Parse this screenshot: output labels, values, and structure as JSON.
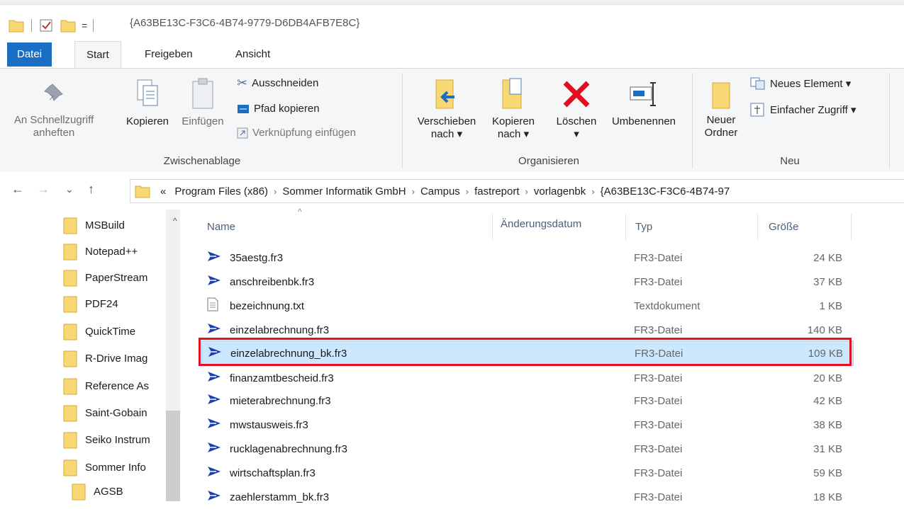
{
  "window": {
    "title": "{A63BE13C-F3C6-4B74-9779-D6DB4AFB7E8C}",
    "qa_dropdown": "="
  },
  "ribbon_tabs": [
    "Datei",
    "Start",
    "Freigeben",
    "Ansicht"
  ],
  "ribbon": {
    "clipboard": {
      "label": "Zwischenablage",
      "pin": "An Schnellzugriff anheften",
      "pin_line1": "An Schnellzugriff",
      "pin_line2": "anheften",
      "copy": "Kopieren",
      "paste": "Einfügen",
      "cut": "Ausschneiden",
      "copy_path": "Pfad kopieren",
      "paste_shortcut": "Verknüpfung einfügen"
    },
    "organize": {
      "label": "Organisieren",
      "move_line1": "Verschieben",
      "move_line2": "nach ▾",
      "copyto_line1": "Kopieren",
      "copyto_line2": "nach ▾",
      "delete": "Löschen",
      "delete_arrow": "▾",
      "rename": "Umbenennen"
    },
    "new": {
      "label": "Neu",
      "new_folder_line1": "Neuer",
      "new_folder_line2": "Ordner",
      "new_item": "Neues Element ▾",
      "easy_access": "Einfacher Zugriff ▾"
    }
  },
  "address": {
    "back": "←",
    "forward": "→",
    "recent": "⌄",
    "up": "↑",
    "overflow": "«",
    "crumbs": [
      "Program Files (x86)",
      "Sommer Informatik GmbH",
      "Campus",
      "fastreport",
      "vorlagenbk",
      "{A63BE13C-F3C6-4B74-97"
    ]
  },
  "nav_pane": {
    "items": [
      "MSBuild",
      "Notepad++",
      "PaperStream",
      "PDF24",
      "QuickTime",
      "R-Drive Imag",
      "Reference As",
      "Saint-Gobain",
      "Seiko Instrum",
      "Sommer Info",
      "AGSB"
    ]
  },
  "columns": {
    "name": "Name",
    "date": "Änderungsdatum",
    "type": "Typ",
    "size": "Größe",
    "sort_indicator": "^"
  },
  "files": [
    {
      "name": "35aestg.fr3",
      "type": "FR3-Datei",
      "size": "24 KB",
      "icon": "fastreport-icon"
    },
    {
      "name": "anschreibenbk.fr3",
      "type": "FR3-Datei",
      "size": "37 KB",
      "icon": "fastreport-icon"
    },
    {
      "name": "bezeichnung.txt",
      "type": "Textdokument",
      "size": "1 KB",
      "icon": "text-file-icon"
    },
    {
      "name": "einzelabrechnung.fr3",
      "type": "FR3-Datei",
      "size": "140 KB",
      "icon": "fastreport-icon"
    },
    {
      "name": "einzelabrechnung_bk.fr3",
      "type": "FR3-Datei",
      "size": "109 KB",
      "icon": "fastreport-icon",
      "selected": true
    },
    {
      "name": "finanzamtbescheid.fr3",
      "type": "FR3-Datei",
      "size": "20 KB",
      "icon": "fastreport-icon"
    },
    {
      "name": "mieterabrechnung.fr3",
      "type": "FR3-Datei",
      "size": "42 KB",
      "icon": "fastreport-icon"
    },
    {
      "name": "mwstausweis.fr3",
      "type": "FR3-Datei",
      "size": "38 KB",
      "icon": "fastreport-icon"
    },
    {
      "name": "rucklagenabrechnung.fr3",
      "type": "FR3-Datei",
      "size": "31 KB",
      "icon": "fastreport-icon"
    },
    {
      "name": "wirtschaftsplan.fr3",
      "type": "FR3-Datei",
      "size": "59 KB",
      "icon": "fastreport-icon"
    },
    {
      "name": "zaehlerstamm_bk.fr3",
      "type": "FR3-Datei",
      "size": "18 KB",
      "icon": "fastreport-icon"
    }
  ],
  "colors": {
    "accent": "#1a6fc4",
    "selection": "#cce8ff",
    "highlight": "#e01020"
  }
}
